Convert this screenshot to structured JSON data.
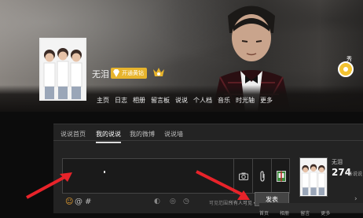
{
  "header": {
    "user_name": "无泪",
    "vip_label": "开通黄钻",
    "side_badge_label": "秀",
    "side_arrow": "›",
    "nav": [
      "主页",
      "日志",
      "相册",
      "留言板",
      "说说",
      "个人档",
      "音乐",
      "时光轴",
      "更多"
    ]
  },
  "panel": {
    "tabs": [
      "说说首页",
      "我的说说",
      "我的微博",
      "说说墙"
    ],
    "active_tab": "我的说说",
    "editor": {
      "caret": ""
    },
    "bottom_icons": {
      "emoji": "☺",
      "at": "@",
      "hash": "#"
    },
    "visibility_label": "可见范围：",
    "visibility_value": "所有人可见 ▾",
    "publish_label": "发表",
    "profile": {
      "name": "无泪",
      "count": "274",
      "count_label": "条说说"
    }
  },
  "strip": [
    "首页",
    "相册",
    "留言",
    "更多"
  ],
  "colors": {
    "accent": "#e7b42c",
    "arrow": "#e8232a",
    "panel_bg": "#232323"
  },
  "icons": [
    "camera-icon",
    "attachment-icon",
    "gift-icon",
    "emoji-icon",
    "at-icon",
    "hash-icon",
    "diamond-icon",
    "crown-icon"
  ]
}
